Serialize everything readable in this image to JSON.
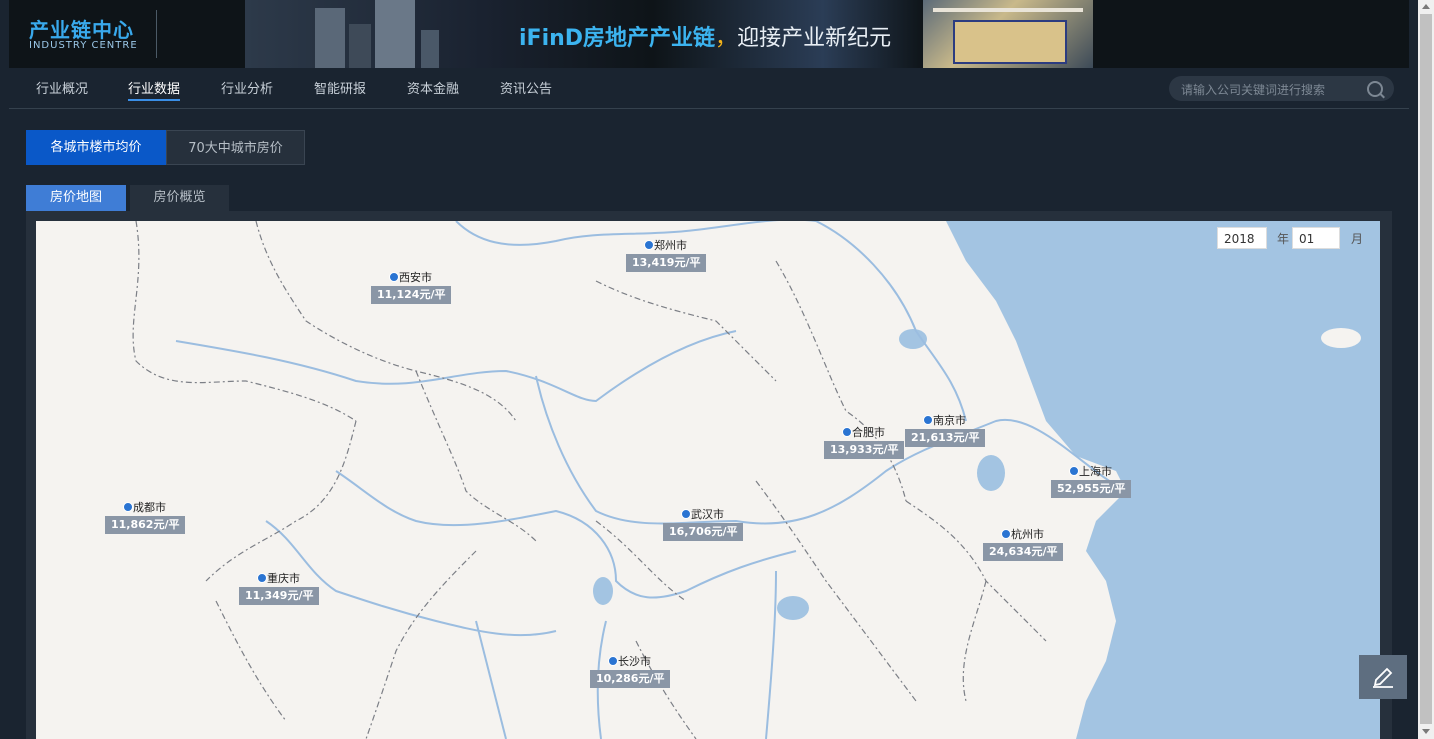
{
  "banner": {
    "logo_cn": "产业链中心",
    "logo_en": "INDUSTRY CENTRE",
    "slogan_highlight": "iFinD房地产产业链",
    "slogan_sep": "，",
    "slogan_rest": "迎接产业新纪元"
  },
  "nav": {
    "items": [
      "行业概况",
      "行业数据",
      "行业分析",
      "智能研报",
      "资本金融",
      "资讯公告"
    ],
    "active": "行业数据",
    "search_placeholder": "请输入公司关键词进行搜索"
  },
  "tabs_primary": [
    "各城市楼市均价",
    "70大中城市房价"
  ],
  "tabs_secondary": [
    "房价地图",
    "房价概览"
  ],
  "date": {
    "year": "2018",
    "year_label": "年",
    "month": "01",
    "month_label": "月"
  },
  "cities": [
    {
      "name": "郑州市",
      "price": "13,419元/平"
    },
    {
      "name": "西安市",
      "price": "11,124元/平"
    },
    {
      "name": "合肥市",
      "price": "13,933元/平"
    },
    {
      "name": "南京市",
      "price": "21,613元/平"
    },
    {
      "name": "上海市",
      "price": "52,955元/平"
    },
    {
      "name": "成都市",
      "price": "11,862元/平"
    },
    {
      "name": "武汉市",
      "price": "16,706元/平"
    },
    {
      "name": "杭州市",
      "price": "24,634元/平"
    },
    {
      "name": "重庆市",
      "price": "11,349元/平"
    },
    {
      "name": "长沙市",
      "price": "10,286元/平"
    }
  ],
  "colors": {
    "accent": "#0a58c8",
    "marker": "#2a74d2",
    "sea": "#a3c4e2",
    "land": "#f5f3f0"
  }
}
